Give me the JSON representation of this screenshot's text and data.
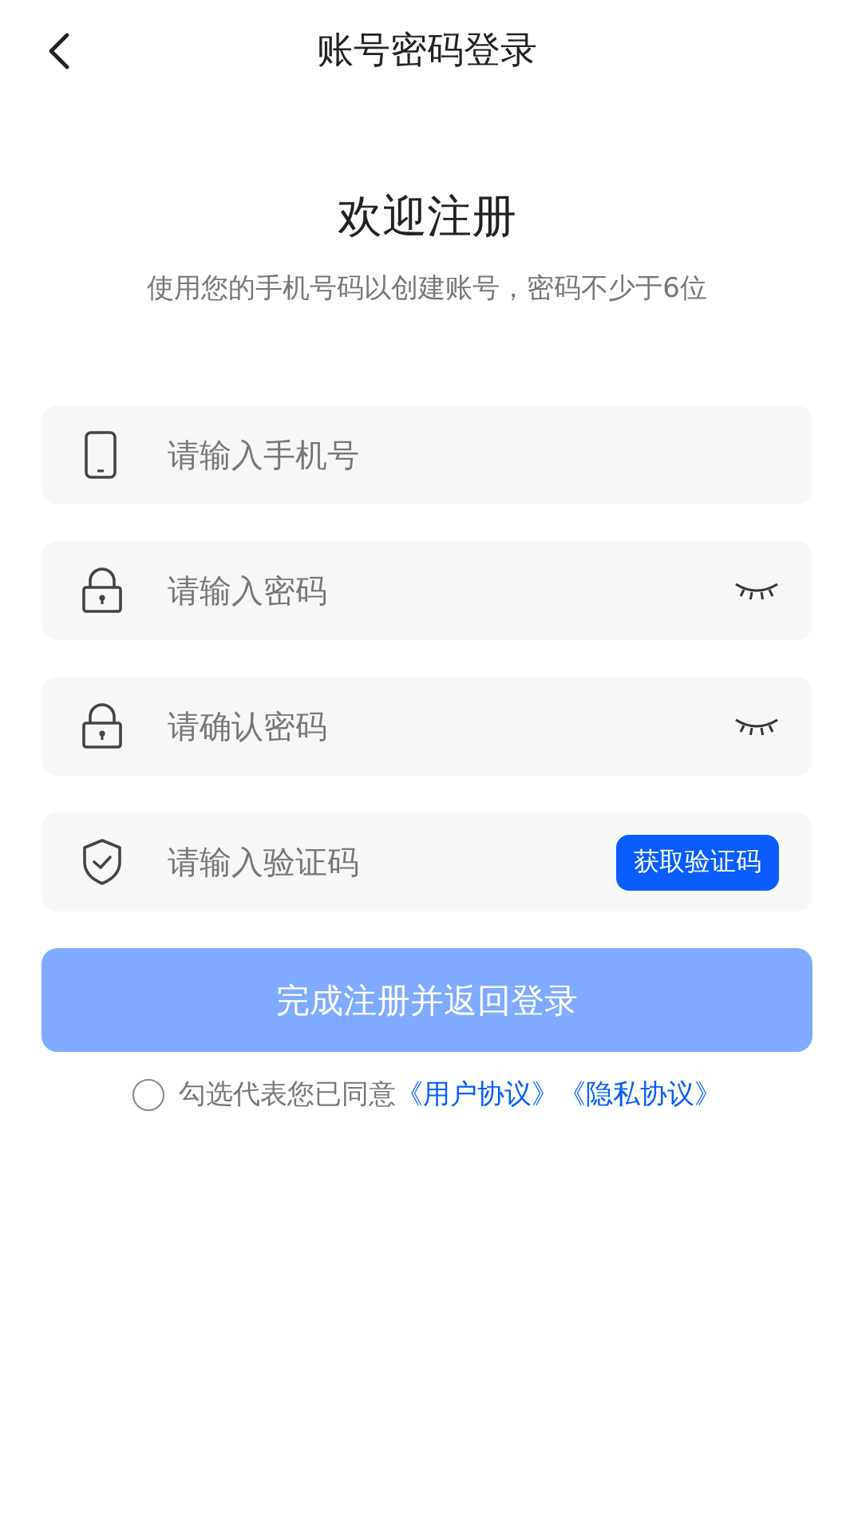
{
  "header": {
    "title": "账号密码登录"
  },
  "welcome": {
    "title": "欢迎注册",
    "subtitle": "使用您的手机号码以创建账号，密码不少于6位"
  },
  "fields": [
    {
      "kind": "phone",
      "placeholder": "请输入手机号"
    },
    {
      "kind": "password",
      "placeholder": "请输入密码",
      "revealed": false
    },
    {
      "kind": "password",
      "placeholder": "请确认密码",
      "revealed": false
    },
    {
      "kind": "code",
      "placeholder": "请输入验证码",
      "action": "获取验证码"
    }
  ],
  "submit": {
    "label": "完成注册并返回登录",
    "disabled": true
  },
  "agreement": {
    "checked": false,
    "text": "勾选代表您已同意",
    "links": [
      "《用户协议》",
      "《隐私协议》"
    ]
  }
}
